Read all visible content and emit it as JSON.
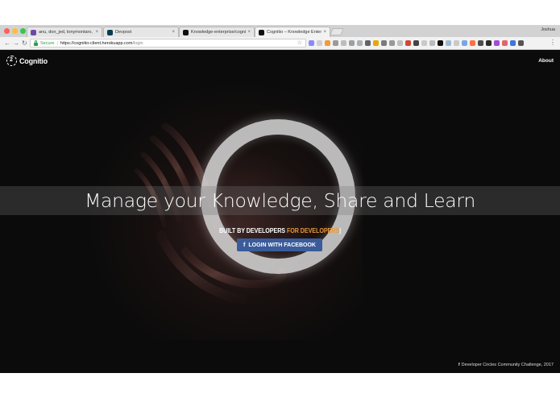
{
  "browser": {
    "tabs": [
      {
        "title": "anu, don_jed, tonymontaro, g...",
        "favicon_color": "#6b4aa6",
        "active": false
      },
      {
        "title": "Devpost",
        "favicon_color": "#003e54",
        "active": false
      },
      {
        "title": "Knowledge-enterprise/cognitio...",
        "favicon_color": "#111111",
        "active": false
      },
      {
        "title": "Cognitio – Knowledge Enterpr...",
        "favicon_color": "#111111",
        "active": true
      }
    ],
    "close_glyph": "×",
    "profile_name": "Joshua",
    "secure_label": "Secure",
    "url_host": "https://cognitio-client.herokuapp.com",
    "url_path": "/login",
    "star_icon": "☆",
    "extension_colors": [
      "#8a8aff",
      "#cfcfcf",
      "#f29b38",
      "#9a9a9a",
      "#bdbdbd",
      "#9aa0a6",
      "#b0b0b0",
      "#5f6368",
      "#e6a800",
      "#7b7b7b",
      "#999999",
      "#c0c0c0",
      "#d44638",
      "#444444",
      "#c9c9c9",
      "#bbbbbb",
      "#111111",
      "#9bbbd4",
      "#c9c9c9",
      "#7aa6e8",
      "#ff7043",
      "#4c4c4c",
      "#2b2b2b",
      "#a04cd6",
      "#e06666",
      "#3c78d8",
      "#555555"
    ]
  },
  "app": {
    "logo_text": "Cognitio",
    "nav_about": "About",
    "headline": "Manage your Knowledge, Share and Learn",
    "tagline_part1": "BUILT BY DEVELOPERS ",
    "tagline_accent": "FOR DEVELOPERS",
    "tagline_cursor": "|",
    "accent_color": "#e8983a",
    "login_button": {
      "icon": "f",
      "label": "LOGIN WITH FACEBOOK",
      "color": "#3b5c9b"
    },
    "footer": {
      "icon": "f",
      "text": "Developer Circles Community Challenge, 2017"
    }
  }
}
